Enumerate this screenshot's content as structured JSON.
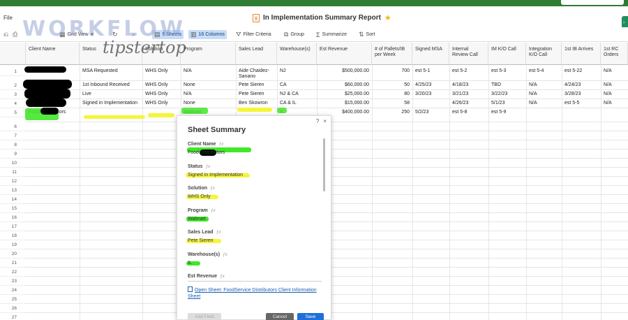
{
  "window": {
    "title": "In Implementation Summary Report"
  },
  "menu": {
    "file": "File"
  },
  "toolbar": {
    "grid_view": "Grid View",
    "sheets": "5 Sheets",
    "columns": "16 Columns",
    "filter": "Filter Criteria",
    "group": "Group",
    "summarize": "Summarize",
    "sort": "Sort"
  },
  "watermark": {
    "line1": "WORKFLOW",
    "line2": "tipstertop"
  },
  "columns": [
    "Client Name",
    "Status",
    "Solution",
    "Program",
    "Sales Lead",
    "Warehouse(s)",
    "Est Revenue",
    "# of Pallets/IB per Week",
    "Signed MSA",
    "Internal Review Call",
    "IM K/O Call",
    "Integration K/O Call",
    "1st IB Arrives",
    "1st RC Orders"
  ],
  "rows": [
    {
      "num": "1",
      "client": "",
      "status": "MSA Requested",
      "solution": "WHS Only",
      "program": "N/A",
      "lead": "Aide Chaidez-Sanano",
      "warehouse": "NJ",
      "revenue": "$500,000.00",
      "pallets": "700",
      "msa": "est 5-1",
      "review": "est 5-2",
      "im": "est 5-3",
      "integration": "est 5-4",
      "ib": "est 5-22",
      "rc": "N/A"
    },
    {
      "num": "2",
      "client": "",
      "status": "1st Inbound Received",
      "solution": "WHS Only",
      "program": "None",
      "lead": "Pete Sieren",
      "warehouse": "CA",
      "revenue": "$60,000.00",
      "pallets": "50",
      "msa": "4/25/23",
      "review": "4/18/23",
      "im": "TBD",
      "integration": "N/A",
      "ib": "4/24/23",
      "rc": "N/A"
    },
    {
      "num": "3",
      "client": "",
      "status": "Live",
      "solution": "WHS Only",
      "program": "N/A",
      "lead": "Pete Sieren",
      "warehouse": "NJ & CA",
      "revenue": "$25,000.00",
      "pallets": "80",
      "msa": "3/20/23",
      "review": "3/21/23",
      "im": "3/22/23",
      "integration": "N/A",
      "ib": "3/28/23",
      "rc": "N/A"
    },
    {
      "num": "4",
      "client": "",
      "status": "Signed in Implementation",
      "solution": "WHS Only",
      "program": "None",
      "lead": "Ben Skowron",
      "warehouse": "CA & IL",
      "revenue": "$15,000.00",
      "pallets": "58",
      "msa": "",
      "review": "4/26/23",
      "im": "5/1/23",
      "integration": "N/A",
      "ib": "est 5-5",
      "rc": "N/A"
    },
    {
      "num": "5",
      "client": "Food Distributors",
      "status": "",
      "solution": "",
      "program": "Walmart",
      "lead": "",
      "warehouse": "IL",
      "revenue": "$400,000.00",
      "pallets": "250",
      "msa": "5/2/23",
      "review": "est 5-8",
      "im": "est 5-9",
      "integration": "",
      "ib": "",
      "rc": ""
    }
  ],
  "empty_rows": [
    "6",
    "7",
    "8",
    "9",
    "10",
    "11",
    "12",
    "13",
    "14",
    "15",
    "16",
    "17",
    "18",
    "19",
    "20",
    "21",
    "22",
    "23",
    "24",
    "25",
    "26",
    "27"
  ],
  "panel": {
    "title": "Sheet Summary",
    "help": "?",
    "close": "×",
    "fx": "ƒx",
    "fields": [
      {
        "label": "Client Name",
        "value": "Food Distributors"
      },
      {
        "label": "Status",
        "value": "Signed in Implementation"
      },
      {
        "label": "Solution",
        "value": "WHS Only"
      },
      {
        "label": "Program",
        "value": "Walmart"
      },
      {
        "label": "Sales Lead",
        "value": "Pete Sieren"
      },
      {
        "label": "Warehouse(s)",
        "value": "IL"
      },
      {
        "label": "Est Revenue",
        "value": ""
      }
    ],
    "open_sheet": "Open Sheet: FoodService Distributors Client Information Sheet",
    "add_field": "Add Field",
    "cancel": "Cancel",
    "save": "Save"
  },
  "colors": {
    "highlight_yellow": "#f5f53a",
    "highlight_green": "#43e62a",
    "accent_blue": "#1e6fd9"
  }
}
